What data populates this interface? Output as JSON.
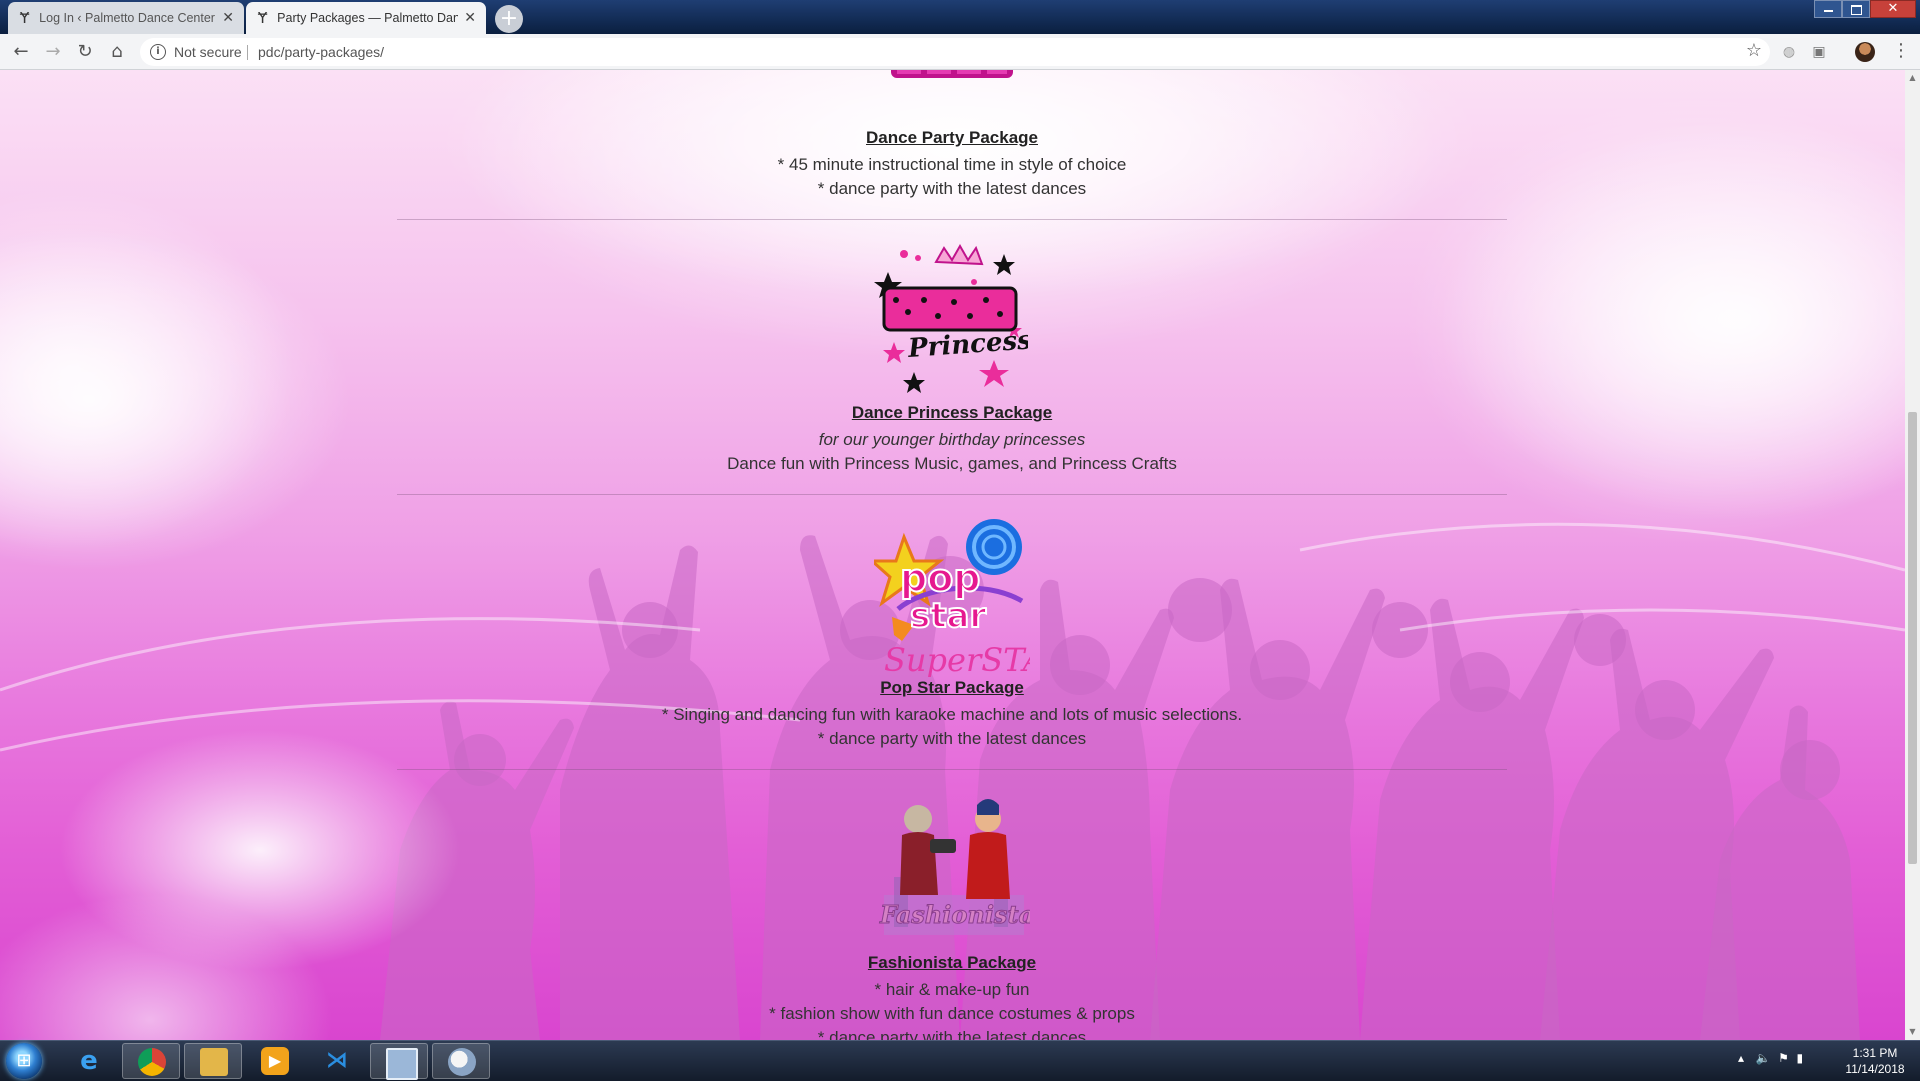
{
  "browser": {
    "tabs": [
      {
        "title": "Log In ‹ Palmetto Dance Center —",
        "active": false
      },
      {
        "title": "Party Packages — Palmetto Danc",
        "active": true
      }
    ],
    "new_tab_label": "+",
    "security_label": "Not secure",
    "url": "pdc/party-packages/",
    "icons": [
      "back-icon",
      "forward-icon",
      "reload-icon",
      "home-icon",
      "info-icon",
      "star-icon",
      "extension-icon",
      "profile-avatar",
      "menu-icon"
    ]
  },
  "page": {
    "packages": [
      {
        "title": "Dance Party Package",
        "lines": [
          {
            "text": "* 45 minute instructional time in style of choice",
            "italic": false
          },
          {
            "text": "* dance party with the latest dances",
            "italic": false
          }
        ],
        "logo": "dance-party-logo"
      },
      {
        "title": "Dance Princess Package",
        "lines": [
          {
            "text": "for our younger birthday princesses",
            "italic": true
          },
          {
            "text": "Dance fun with Princess Music, games, and Princess Crafts",
            "italic": false
          }
        ],
        "logo": "dance-princess-logo",
        "logo_text": "DANCE Princess"
      },
      {
        "title": "Pop Star Package",
        "lines": [
          {
            "text": "* Singing and dancing fun with karaoke machine and lots of music selections.",
            "italic": false
          },
          {
            "text": "* dance party with the latest dances",
            "italic": false
          }
        ],
        "logo": "pop-star-logo",
        "logo_text": "pop star",
        "logo_subtext": "SuperSTARS"
      },
      {
        "title": "Fashionista Package",
        "lines": [
          {
            "text": "* hair & make-up fun",
            "italic": false
          },
          {
            "text": "* fashion show with fun dance costumes & props",
            "italic": false
          },
          {
            "text": "* dance party with the latest dances",
            "italic": false
          }
        ],
        "logo": "fashionista-logo",
        "logo_text": "Fashionista"
      }
    ],
    "colors": {
      "accent_pink": "#e35fd6",
      "logo_magenta": "#d6168f"
    }
  },
  "taskbar": {
    "apps": [
      "start-button",
      "internet-explorer-icon",
      "chrome-icon",
      "file-explorer-icon",
      "media-player-icon",
      "visual-studio-code-icon",
      "remote-desktop-icon",
      "paint-icon"
    ],
    "clock_time": "1:31 PM",
    "clock_date": "11/14/2018"
  }
}
